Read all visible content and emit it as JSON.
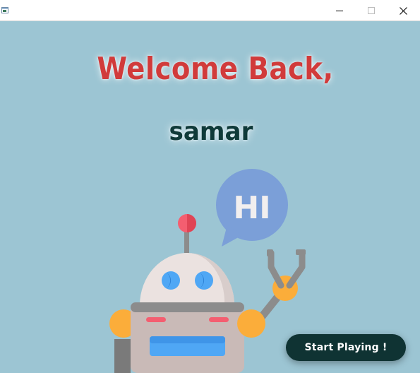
{
  "window": {
    "controls": {
      "minimize_icon": "minimize-icon",
      "maximize_icon": "maximize-icon",
      "close_icon": "close-icon"
    }
  },
  "main": {
    "welcome_text": "Welcome Back,",
    "username": "samar",
    "speech_bubble_text": "HI",
    "start_button_label": "Start Playing !"
  },
  "colors": {
    "background": "#9cc5d3",
    "welcome": "#d13b3b",
    "username": "#0f3a39",
    "button": "#0f3333",
    "bubble": "#7b9fd8"
  }
}
